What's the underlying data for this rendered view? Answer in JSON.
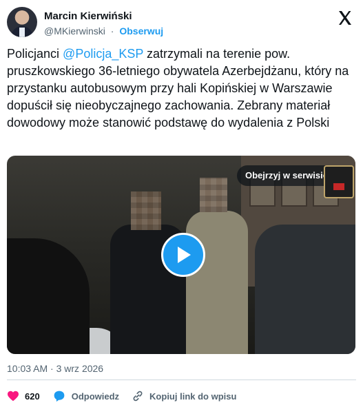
{
  "author": {
    "name": "Marcin Kierwiński",
    "handle": "@MKierwinski",
    "separator": "·",
    "follow_label": "Obserwuj"
  },
  "tweet": {
    "text_before": "Policjanci ",
    "mention": "@Policja_KSP",
    "text_after": " zatrzymali na terenie pow. pruszkowskiego 36-letniego obywatela Azerbejdżanu, który na przystanku autobusowym przy hali Kopińskiej w Warszawie dopuścił się nieobyczajnego zachowania. Zebrany materiał dowodowy może stanowić podstawę do wydalenia z Polski"
  },
  "media": {
    "watch_label": "Obejrzyj w serwisie X"
  },
  "meta": {
    "time": "10:03 AM",
    "separator": "·",
    "date": "3 wrz 2026"
  },
  "actions": {
    "likes": "620",
    "reply_label": "Odpowiedz",
    "copy_label": "Kopiuj link do wpisu"
  },
  "colors": {
    "accent": "#1d9bf0",
    "like": "#f91880",
    "muted": "#536471"
  },
  "icons": [
    "x-logo-icon",
    "play-icon",
    "heart-icon",
    "reply-icon",
    "link-icon"
  ]
}
